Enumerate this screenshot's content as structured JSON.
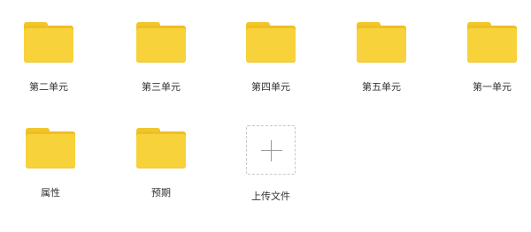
{
  "folders": [
    {
      "label": "第二单元",
      "icon": "folder-icon"
    },
    {
      "label": "第三单元",
      "icon": "folder-icon"
    },
    {
      "label": "第四单元",
      "icon": "folder-icon"
    },
    {
      "label": "第五单元",
      "icon": "folder-icon"
    },
    {
      "label": "第一单元",
      "icon": "folder-icon"
    },
    {
      "label": "属性",
      "icon": "folder-icon"
    },
    {
      "label": "预期",
      "icon": "folder-icon"
    }
  ],
  "upload": {
    "label": "上传文件",
    "icon": "plus-icon"
  },
  "colors": {
    "folder_front": "#f8d23a",
    "folder_back": "#eebf24",
    "folder_tab": "#f1c62a",
    "text": "#333333",
    "upload_border": "#c8c8c8",
    "plus": "#9a9a9a"
  }
}
